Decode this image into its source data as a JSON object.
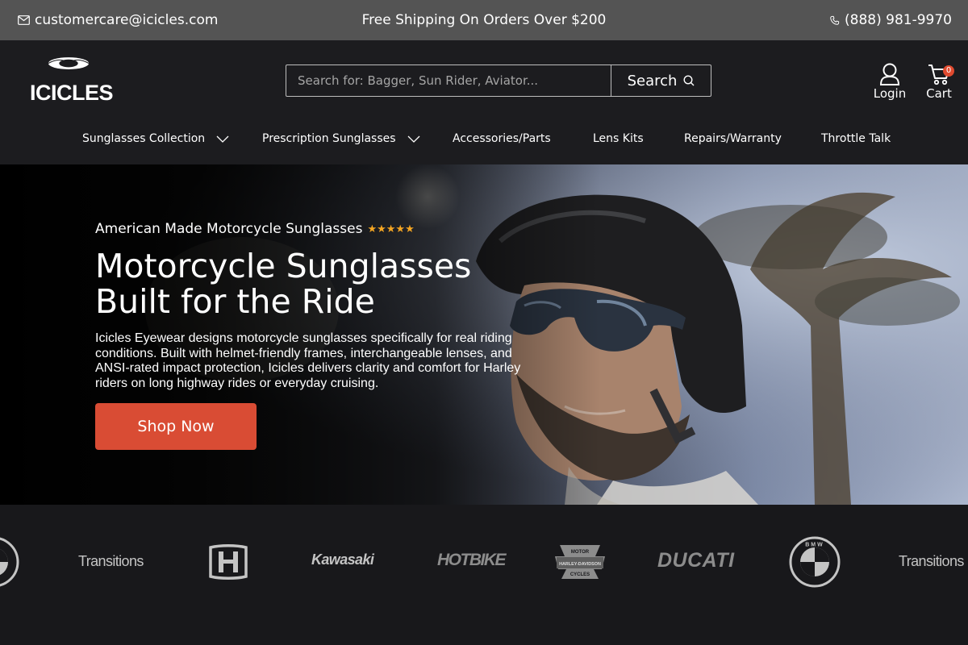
{
  "topbar": {
    "email": "customercare@icicles.com",
    "promo": "Free Shipping On Orders Over $200",
    "phone": "(888) 981-9970",
    "icons": {
      "email": "mail-icon",
      "phone": "phone-icon"
    }
  },
  "header": {
    "logo_text": "ICICLES",
    "search": {
      "placeholder": "Search for: Bagger, Sun Rider, Aviator...",
      "value": "",
      "button_label": "Search"
    },
    "login_label": "Login",
    "cart_label": "Cart",
    "cart_count": "0"
  },
  "nav": {
    "items": [
      {
        "label": "Sunglasses Collection",
        "dropdown": true
      },
      {
        "label": "Prescription Sunglasses",
        "dropdown": true
      },
      {
        "label": "Accessories/Parts",
        "dropdown": false
      },
      {
        "label": "Lens Kits",
        "dropdown": false
      },
      {
        "label": "Repairs/Warranty",
        "dropdown": false
      },
      {
        "label": "Throttle Talk",
        "dropdown": false
      }
    ]
  },
  "hero": {
    "kicker": "American Made Motorcycle Sunglasses",
    "rating": 5,
    "headline_line1": "Motorcycle Sunglasses",
    "headline_line2": "Built for the Ride",
    "description": "Icicles Eyewear designs motorcycle sunglasses specifically for real riding conditions. Built with helmet-friendly frames, interchangeable lenses, and ANSI-rated impact protection, Icicles delivers clarity and comfort for Harley riders on long highway rides or everyday cruising.",
    "cta_label": "Shop Now"
  },
  "brands": {
    "items": [
      "BMW",
      "Transitions",
      "Honda",
      "Kawasaki",
      "HOTBIKE",
      "Harley-Davidson",
      "DUCATI",
      "BMW",
      "Transitions"
    ],
    "transitions_text": "Transitions",
    "kawasaki_text": "Kawasaki",
    "hotbike_text": "HOTBIKE",
    "ducati_text": "DUCATI",
    "harley_top": "MOTOR",
    "harley_middle": "HARLEY-DAVIDSON",
    "harley_bottom": "CYCLES",
    "bmw_text": "BMW"
  },
  "colors": {
    "accent": "#d94c34",
    "topbar": "#545454",
    "header": "#1c1c1f",
    "star": "#f5a623"
  }
}
